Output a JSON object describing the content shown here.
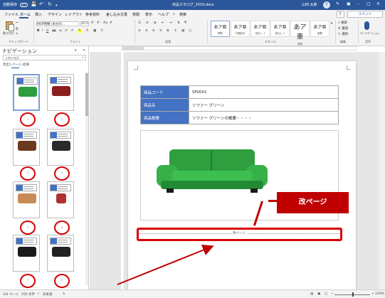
{
  "title_bar": {
    "autosave": "自動保存",
    "autosave_state": "オフ",
    "filename": "商品カタログ_2019.docx",
    "user_name": "山田 太郎",
    "avatar_initial": "Y"
  },
  "menu": {
    "tabs": [
      "ファイル",
      "ホーム",
      "挿入",
      "デザイン",
      "レイアウト",
      "参考資料",
      "差し込み文書",
      "校閲",
      "表示",
      "ヘルプ"
    ],
    "search": "検索",
    "comment": "コメント"
  },
  "ribbon": {
    "paste": "貼り付け",
    "font_name": "MSP明朝 (本文の...",
    "font_size": "10.5",
    "clipboard": "クリップボード",
    "font": "フォント",
    "paragraph": "段落",
    "style": "スタイル",
    "styles": [
      {
        "sample": "あア亜",
        "name": "標準"
      },
      {
        "sample": "あア亜",
        "name": "行間詰め"
      },
      {
        "sample": "あア亜",
        "name": "見出し 1"
      },
      {
        "sample": "あア亜",
        "name": "見出し 2"
      },
      {
        "sample": "あア亜",
        "name": "表題"
      },
      {
        "sample": "あア亜",
        "name": "副題"
      }
    ],
    "find": "検索",
    "replace": "置換",
    "select": "選択",
    "editing": "編集",
    "dictate": "ディクテーション",
    "voice": "音声"
  },
  "nav": {
    "title": "ナビゲーション",
    "search_placeholder": "文書の検索",
    "tabs": [
      "見出し",
      "ページ",
      "結果"
    ],
    "page_numbers": [
      "1",
      "2",
      "3",
      "4",
      "5",
      "6",
      "7",
      "8"
    ]
  },
  "document": {
    "rows": [
      {
        "key": "商品コード",
        "value": "SF0001"
      },
      {
        "key": "商品名",
        "value": "ソファー グリーン"
      },
      {
        "key": "商品概要",
        "value": "ソファー グリーンの概要・・・・"
      }
    ],
    "page_break": "改ページ",
    "callout": "改ページ"
  },
  "status": {
    "page": "1/4 ページ",
    "words": "250 文字",
    "language": "日本語",
    "zoom": "120%"
  }
}
